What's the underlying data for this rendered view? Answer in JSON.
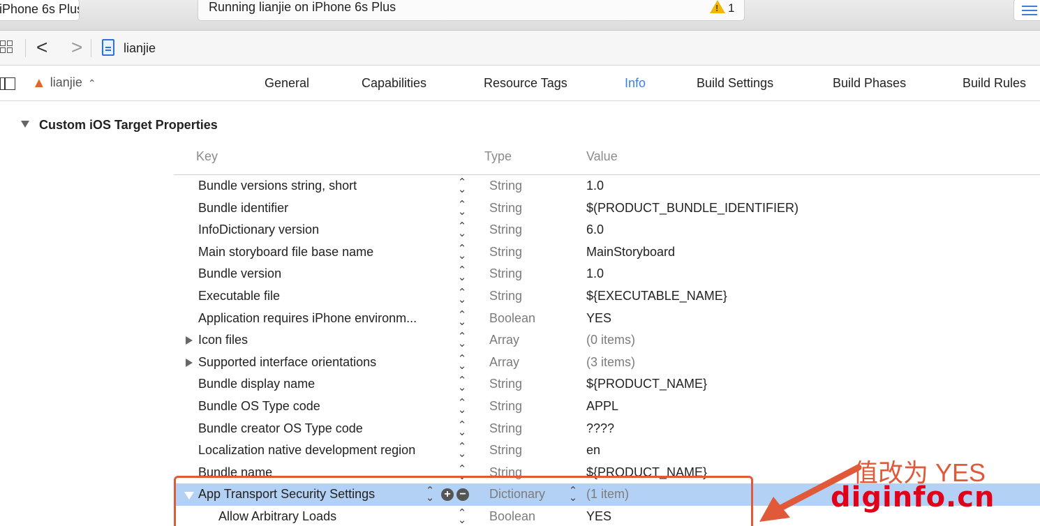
{
  "toolbar": {
    "scheme_label": "iPhone 6s Plus",
    "activity_text": "Running lianjie on iPhone 6s Plus",
    "warning_count": "1"
  },
  "jumpbar": {
    "back_glyph": "<",
    "forward_glyph": ">",
    "file_name": "lianjie"
  },
  "tabbar": {
    "target_name": "lianjie",
    "target_chevron": "⌃⌄",
    "tabs": [
      {
        "label": "General"
      },
      {
        "label": "Capabilities"
      },
      {
        "label": "Resource Tags"
      },
      {
        "label": "Info"
      },
      {
        "label": "Build Settings"
      },
      {
        "label": "Build Phases"
      },
      {
        "label": "Build Rules"
      }
    ],
    "active_tab": "Info"
  },
  "section": {
    "title": "Custom iOS Target Properties"
  },
  "table": {
    "headers": {
      "key": "Key",
      "type": "Type",
      "value": "Value"
    },
    "rows": [
      {
        "key": "Bundle versions string, short",
        "type": "String",
        "value": "1.0"
      },
      {
        "key": "Bundle identifier",
        "type": "String",
        "value": "$(PRODUCT_BUNDLE_IDENTIFIER)"
      },
      {
        "key": "InfoDictionary version",
        "type": "String",
        "value": "6.0"
      },
      {
        "key": "Main storyboard file base name",
        "type": "String",
        "value": "MainStoryboard"
      },
      {
        "key": "Bundle version",
        "type": "String",
        "value": "1.0"
      },
      {
        "key": "Executable file",
        "type": "String",
        "value": "${EXECUTABLE_NAME}"
      },
      {
        "key": "Application requires iPhone environm...",
        "type": "Boolean",
        "value": "YES"
      },
      {
        "key": "Icon files",
        "type": "Array",
        "value": "(0 items)"
      },
      {
        "key": "Supported interface orientations",
        "type": "Array",
        "value": "(3 items)"
      },
      {
        "key": "Bundle display name",
        "type": "String",
        "value": "${PRODUCT_NAME}"
      },
      {
        "key": "Bundle OS Type code",
        "type": "String",
        "value": "APPL"
      },
      {
        "key": "Bundle creator OS Type code",
        "type": "String",
        "value": "????"
      },
      {
        "key": "Localization native development region",
        "type": "String",
        "value": "en"
      },
      {
        "key": "Bundle name",
        "type": "String",
        "value": "${PRODUCT_NAME}"
      },
      {
        "key": "App Transport Security Settings",
        "type": "Dictionary",
        "value": "(1 item)"
      },
      {
        "key": "Allow Arbitrary Loads",
        "type": "Boolean",
        "value": "YES"
      }
    ]
  },
  "annotation": {
    "note": "值改为 YES",
    "brand": "diginfo.cn"
  },
  "colors": {
    "accent": "#3b82e0",
    "selection": "#b3d1f5",
    "annotation": "#e05a3a",
    "brand": "#e0001a"
  }
}
